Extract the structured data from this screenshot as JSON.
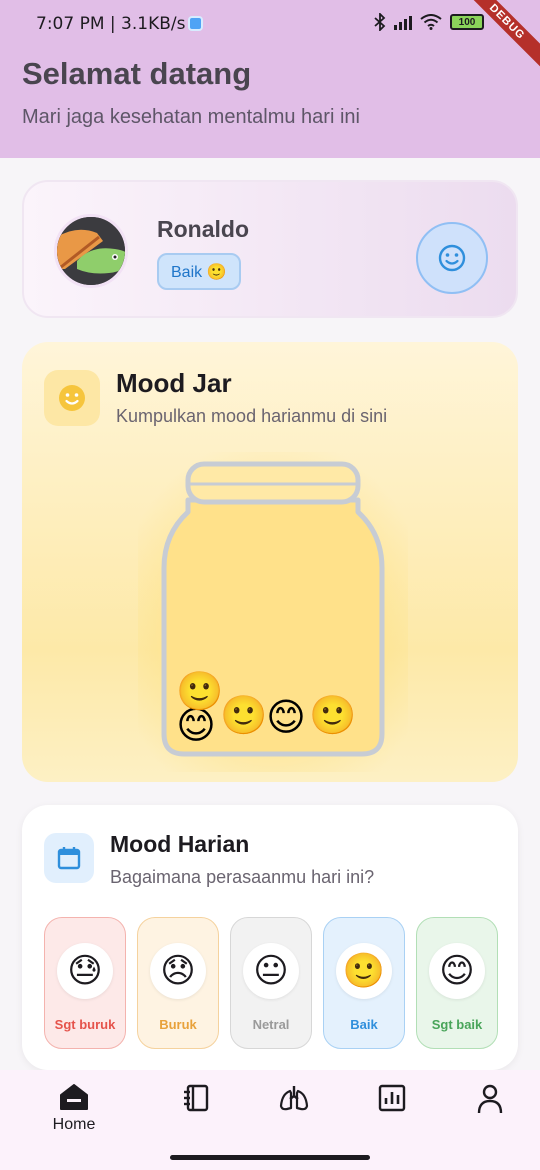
{
  "status_bar": {
    "time": "7:07 PM | 3.1KB/s",
    "battery": "100",
    "debug_banner": "DEBUG"
  },
  "header": {
    "title": "Selamat datang",
    "subtitle": "Mari jaga kesehatan mentalmu hari ini"
  },
  "profile": {
    "name": "Ronaldo",
    "mood_badge": "Baik 🙂",
    "mood_icon": "smile-icon"
  },
  "mood_jar": {
    "title": "Mood Jar",
    "subtitle": "Kumpulkan mood harianmu di sini",
    "icon": "smile-icon",
    "emojis": [
      "😊",
      "🙂",
      "🙂",
      "😊",
      "🙂"
    ]
  },
  "mood_harian": {
    "title": "Mood Harian",
    "subtitle": "Bagaimana perasaanmu hari ini?",
    "icon": "calendar-icon",
    "options": [
      {
        "emoji": "😓",
        "label": "Sgt buruk",
        "color": "#e5534b",
        "bg": "#fde9e8",
        "border": "#f4b3ae"
      },
      {
        "emoji": "😞",
        "label": "Buruk",
        "color": "#e8a13a",
        "bg": "#fef3e2",
        "border": "#f5d29e"
      },
      {
        "emoji": "😐",
        "label": "Netral",
        "color": "#9a9a9a",
        "bg": "#f2f2f2",
        "border": "#d7d7d7"
      },
      {
        "emoji": "🙂",
        "label": "Baik",
        "color": "#2f8fdc",
        "bg": "#e4f1fd",
        "border": "#a9d1f4"
      },
      {
        "emoji": "😊",
        "label": "Sgt baik",
        "color": "#49a55a",
        "bg": "#e9f6ea",
        "border": "#b2dfb6"
      }
    ]
  },
  "nav": {
    "home_label": "Home",
    "items": [
      "home-icon",
      "journal-icon",
      "lungs-icon",
      "stats-icon",
      "profile-icon"
    ]
  },
  "colors": {
    "header_bg": "#e1bee7",
    "accent_blue": "#2076c9",
    "jar_yellow": "#fde9a8"
  }
}
